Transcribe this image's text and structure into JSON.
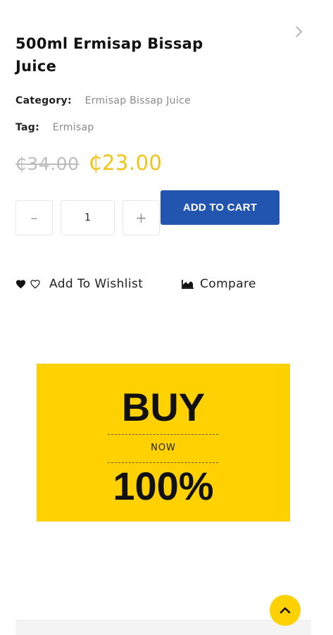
{
  "product": {
    "title": "500ml Ermisap Bissap Juice",
    "category_label": "Category:",
    "category_value": "Ermisap Bissap Juice",
    "tag_label": "Tag:",
    "tag_value": "Ermisap",
    "price_old": "₵34.00",
    "price_new": "₵23.00"
  },
  "cart": {
    "minus": "–",
    "quantity": "1",
    "plus": "+",
    "add_label": "ADD TO CART"
  },
  "actions": {
    "wishlist_label": "Add To Wishlist",
    "compare_label": "Compare"
  },
  "banner": {
    "line1": "BUY",
    "line2": "NOW",
    "line3": "100%"
  },
  "colors": {
    "accent_yellow": "#ffd100",
    "price_yellow": "#f2c418",
    "button_blue": "#2155b0"
  },
  "icons": [
    "chevron-right-icon",
    "heart-filled-icon",
    "heart-outline-icon",
    "compare-chart-icon",
    "chevron-up-icon"
  ]
}
